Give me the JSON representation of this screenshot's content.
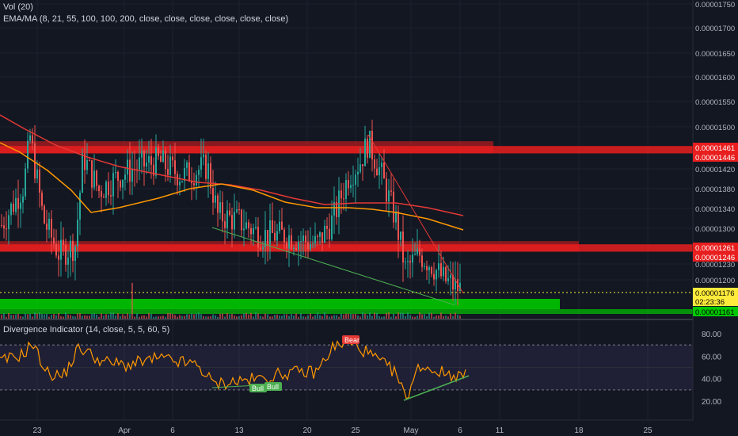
{
  "legend": {
    "vol": "Vol (20)",
    "ema": "EMA/MA (8, 21, 55, 100, 100, 200, close, close, close, close, close, close)",
    "divergence": "Divergence Indicator (14, close, 5, 5, 60, 5)"
  },
  "price_axis": {
    "ticks": [
      "0.00001750",
      "0.00001700",
      "0.00001650",
      "0.00001600",
      "0.00001550",
      "0.00001500",
      "0.00001420",
      "0.00001380",
      "0.00001340",
      "0.00001300",
      "0.00001230",
      "0.00001200"
    ],
    "labels": [
      {
        "text": "0.00001461",
        "bg": "#e91e1e",
        "fg": "#ffffff"
      },
      {
        "text": "0.00001446",
        "bg": "#e91e1e",
        "fg": "#ffffff"
      },
      {
        "text": "0.00001261",
        "bg": "#e91e1e",
        "fg": "#ffffff"
      },
      {
        "text": "0.00001246",
        "bg": "#e91e1e",
        "fg": "#ffffff"
      },
      {
        "text": "0.00001176",
        "bg": "#ffeb3b",
        "fg": "#000000"
      },
      {
        "text": "02:23:36",
        "bg": "#ffeb3b",
        "fg": "#000000"
      },
      {
        "text": "0.00001161",
        "bg": "#00c800",
        "fg": "#000000"
      }
    ]
  },
  "osc_axis": {
    "ticks": [
      "80.00",
      "60.00",
      "40.00",
      "20.00"
    ]
  },
  "time_axis": {
    "labels": [
      "23",
      "Apr",
      "6",
      "13",
      "20",
      "25",
      "May",
      "6",
      "11",
      "18",
      "25"
    ]
  },
  "markers": {
    "bear": "Bear",
    "bull1": "Bull",
    "bull2": "Bull"
  },
  "colors": {
    "background": "#131722",
    "up": "#26a69a",
    "down": "#ef5350",
    "resistance": "#e91e1e",
    "support": "#00c800",
    "ma_red": "#e53935",
    "ma_orange": "#ff9800",
    "rsi": "#ff9800",
    "trend_green": "#4caf50",
    "trend_red": "#e53935"
  },
  "chart_data": {
    "type": "candlestick",
    "title": "",
    "ylim": [
      1.15e-05,
      1.76e-05
    ],
    "x_labels": [
      "23",
      "Apr",
      "6",
      "13",
      "20",
      "25",
      "May",
      "6",
      "11",
      "18",
      "25"
    ],
    "zones": [
      {
        "name": "resistance-upper",
        "from": 1.446e-05,
        "to": 1.461e-05
      },
      {
        "name": "resistance-lower",
        "from": 1.246e-05,
        "to": 1.261e-05
      },
      {
        "name": "support",
        "from": 1.161e-05,
        "to": 1.176e-05
      }
    ],
    "last_price": 1.176e-05,
    "countdown": "02:23:36",
    "oscillator": {
      "name": "Divergence Indicator",
      "ylim": [
        10,
        90
      ],
      "bands": [
        30,
        70
      ],
      "ticks": [
        80,
        60,
        40,
        20
      ]
    }
  }
}
